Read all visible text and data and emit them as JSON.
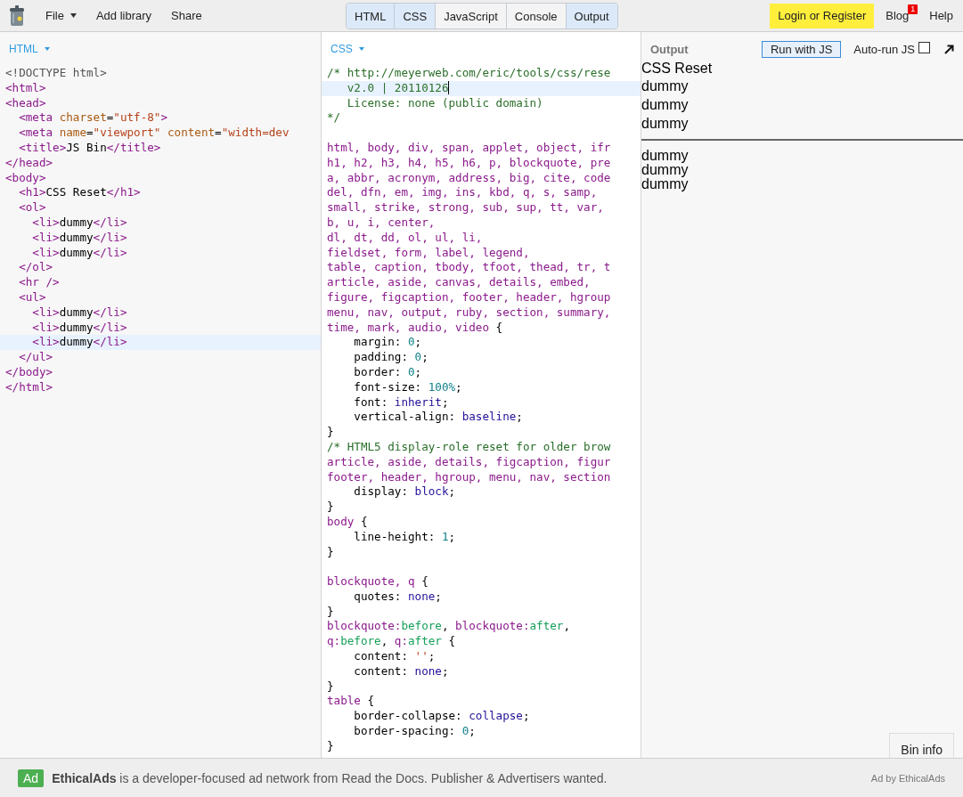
{
  "top_bar": {
    "menu": [
      {
        "label": "File",
        "dropdown": true
      },
      {
        "label": "Add library",
        "dropdown": false
      },
      {
        "label": "Share",
        "dropdown": false
      }
    ],
    "tabs": [
      {
        "label": "HTML",
        "selected": true
      },
      {
        "label": "CSS",
        "selected": true
      },
      {
        "label": "JavaScript",
        "selected": false
      },
      {
        "label": "Console",
        "selected": false
      },
      {
        "label": "Output",
        "selected": true
      }
    ],
    "login": "Login or Register",
    "blog": {
      "label": "Blog",
      "badge": "1"
    },
    "help": "Help"
  },
  "html_pane": {
    "title": "HTML",
    "lines": [
      {
        "active": false,
        "tokens": [
          {
            "kind": "doc",
            "text": "<!DOCTYPE html>"
          }
        ]
      },
      {
        "active": false,
        "tokens": [
          {
            "kind": "tag",
            "text": "<html>"
          }
        ]
      },
      {
        "active": false,
        "tokens": [
          {
            "kind": "tag",
            "text": "<head>"
          }
        ]
      },
      {
        "active": false,
        "tokens": [
          {
            "kind": "tag",
            "text": "  <meta "
          },
          {
            "kind": "attr",
            "text": "charset"
          },
          {
            "kind": "plain",
            "text": "="
          },
          {
            "kind": "str",
            "text": "\"utf-8\""
          },
          {
            "kind": "tag",
            "text": ">"
          }
        ]
      },
      {
        "active": false,
        "tokens": [
          {
            "kind": "tag",
            "text": "  <meta "
          },
          {
            "kind": "attr",
            "text": "name"
          },
          {
            "kind": "plain",
            "text": "="
          },
          {
            "kind": "str",
            "text": "\"viewport\" "
          },
          {
            "kind": "attr",
            "text": "content"
          },
          {
            "kind": "plain",
            "text": "="
          },
          {
            "kind": "str",
            "text": "\"width=dev"
          }
        ]
      },
      {
        "active": false,
        "tokens": [
          {
            "kind": "tag",
            "text": "  <title>"
          },
          {
            "kind": "plain",
            "text": "JS Bin"
          },
          {
            "kind": "tag",
            "text": "</title>"
          }
        ]
      },
      {
        "active": false,
        "tokens": [
          {
            "kind": "tag",
            "text": "</head>"
          }
        ]
      },
      {
        "active": false,
        "tokens": [
          {
            "kind": "tag",
            "text": "<body>"
          }
        ]
      },
      {
        "active": false,
        "tokens": [
          {
            "kind": "tag",
            "text": "  <h1>"
          },
          {
            "kind": "plain",
            "text": "CSS Reset"
          },
          {
            "kind": "tag",
            "text": "</h1>"
          }
        ]
      },
      {
        "active": false,
        "tokens": [
          {
            "kind": "tag",
            "text": "  <ol>"
          }
        ]
      },
      {
        "active": false,
        "tokens": [
          {
            "kind": "tag",
            "text": "    <li>"
          },
          {
            "kind": "plain",
            "text": "dummy"
          },
          {
            "kind": "tag",
            "text": "</li>"
          }
        ]
      },
      {
        "active": false,
        "tokens": [
          {
            "kind": "tag",
            "text": "    <li>"
          },
          {
            "kind": "plain",
            "text": "dummy"
          },
          {
            "kind": "tag",
            "text": "</li>"
          }
        ]
      },
      {
        "active": false,
        "tokens": [
          {
            "kind": "tag",
            "text": "    <li>"
          },
          {
            "kind": "plain",
            "text": "dummy"
          },
          {
            "kind": "tag",
            "text": "</li>"
          }
        ]
      },
      {
        "active": false,
        "tokens": [
          {
            "kind": "tag",
            "text": "  </ol>"
          }
        ]
      },
      {
        "active": false,
        "tokens": [
          {
            "kind": "tag",
            "text": "  <hr />"
          }
        ]
      },
      {
        "active": false,
        "tokens": [
          {
            "kind": "tag",
            "text": "  <ul>"
          }
        ]
      },
      {
        "active": false,
        "tokens": [
          {
            "kind": "tag",
            "text": "    <li>"
          },
          {
            "kind": "plain",
            "text": "dummy"
          },
          {
            "kind": "tag",
            "text": "</li>"
          }
        ]
      },
      {
        "active": false,
        "tokens": [
          {
            "kind": "tag",
            "text": "    <li>"
          },
          {
            "kind": "plain",
            "text": "dummy"
          },
          {
            "kind": "tag",
            "text": "</li>"
          }
        ]
      },
      {
        "active": true,
        "tokens": [
          {
            "kind": "tag",
            "text": "    <li>"
          },
          {
            "kind": "plain",
            "text": "dummy"
          },
          {
            "kind": "tag",
            "text": "</li>"
          }
        ]
      },
      {
        "active": false,
        "tokens": [
          {
            "kind": "tag",
            "text": "  </ul>"
          }
        ]
      },
      {
        "active": false,
        "tokens": [
          {
            "kind": "tag",
            "text": "</body>"
          }
        ]
      },
      {
        "active": false,
        "tokens": [
          {
            "kind": "tag",
            "text": "</html>"
          }
        ]
      }
    ]
  },
  "css_pane": {
    "title": "CSS",
    "lines": [
      {
        "active": false,
        "tokens": [
          {
            "kind": "com",
            "text": "/* http://meyerweb.com/eric/tools/css/rese"
          }
        ]
      },
      {
        "active": true,
        "tokens": [
          {
            "kind": "com",
            "text": "   v2.0 | 20110126"
          }
        ]
      },
      {
        "active": false,
        "tokens": [
          {
            "kind": "com",
            "text": "   License: none (public domain)"
          }
        ]
      },
      {
        "active": false,
        "tokens": [
          {
            "kind": "com",
            "text": "*/"
          }
        ]
      },
      {
        "active": false
      },
      {
        "active": false,
        "tokens": [
          {
            "kind": "sel",
            "text": "html, body, div, span, applet, object, ifr"
          }
        ]
      },
      {
        "active": false,
        "tokens": [
          {
            "kind": "sel",
            "text": "h1, h2, h3, h4, h5, h6, p, blockquote, pre"
          }
        ]
      },
      {
        "active": false,
        "tokens": [
          {
            "kind": "sel",
            "text": "a, abbr, acronym, address, big, cite, code"
          }
        ]
      },
      {
        "active": false,
        "tokens": [
          {
            "kind": "sel",
            "text": "del, dfn, em, img, ins, kbd, q, s, samp,"
          }
        ]
      },
      {
        "active": false,
        "tokens": [
          {
            "kind": "sel",
            "text": "small, strike, strong, sub, sup, tt, var,"
          }
        ]
      },
      {
        "active": false,
        "tokens": [
          {
            "kind": "sel",
            "text": "b, u, i, center,"
          }
        ]
      },
      {
        "active": false,
        "tokens": [
          {
            "kind": "sel",
            "text": "dl, dt, dd, ol, ul, li,"
          }
        ]
      },
      {
        "active": false,
        "tokens": [
          {
            "kind": "sel",
            "text": "fieldset, form, label, legend,"
          }
        ]
      },
      {
        "active": false,
        "tokens": [
          {
            "kind": "sel",
            "text": "table, caption, tbody, tfoot, thead, tr, t"
          }
        ]
      },
      {
        "active": false,
        "tokens": [
          {
            "kind": "sel",
            "text": "article, aside, canvas, details, embed,"
          }
        ]
      },
      {
        "active": false,
        "tokens": [
          {
            "kind": "sel",
            "text": "figure, figcaption, footer, header, hgroup"
          }
        ]
      },
      {
        "active": false,
        "tokens": [
          {
            "kind": "sel",
            "text": "menu, nav, output, ruby, section, summary,"
          }
        ]
      },
      {
        "active": false,
        "tokens": [
          {
            "kind": "sel",
            "text": "time, mark, audio, video"
          },
          {
            "kind": "plain",
            "text": " {"
          }
        ]
      },
      {
        "active": false,
        "tokens": [
          {
            "kind": "plain",
            "text": "    margin: "
          },
          {
            "kind": "num",
            "text": "0"
          },
          {
            "kind": "plain",
            "text": ";"
          }
        ]
      },
      {
        "active": false,
        "tokens": [
          {
            "kind": "plain",
            "text": "    padding: "
          },
          {
            "kind": "num",
            "text": "0"
          },
          {
            "kind": "plain",
            "text": ";"
          }
        ]
      },
      {
        "active": false,
        "tokens": [
          {
            "kind": "plain",
            "text": "    border: "
          },
          {
            "kind": "num",
            "text": "0"
          },
          {
            "kind": "plain",
            "text": ";"
          }
        ]
      },
      {
        "active": false,
        "tokens": [
          {
            "kind": "plain",
            "text": "    font-size: "
          },
          {
            "kind": "num",
            "text": "100%"
          },
          {
            "kind": "plain",
            "text": ";"
          }
        ]
      },
      {
        "active": false,
        "tokens": [
          {
            "kind": "plain",
            "text": "    font: "
          },
          {
            "kind": "kw",
            "text": "inherit"
          },
          {
            "kind": "plain",
            "text": ";"
          }
        ]
      },
      {
        "active": false,
        "tokens": [
          {
            "kind": "plain",
            "text": "    vertical-align: "
          },
          {
            "kind": "kw",
            "text": "baseline"
          },
          {
            "kind": "plain",
            "text": ";"
          }
        ]
      },
      {
        "active": false,
        "tokens": [
          {
            "kind": "plain",
            "text": "}"
          }
        ]
      },
      {
        "active": false,
        "tokens": [
          {
            "kind": "com",
            "text": "/* HTML5 display-role reset for older brow"
          }
        ]
      },
      {
        "active": false,
        "tokens": [
          {
            "kind": "sel",
            "text": "article, aside, details, figcaption, figur"
          }
        ]
      },
      {
        "active": false,
        "tokens": [
          {
            "kind": "sel",
            "text": "footer, header, hgroup, menu, nav, section"
          }
        ]
      },
      {
        "active": false,
        "tokens": [
          {
            "kind": "plain",
            "text": "    display: "
          },
          {
            "kind": "kw",
            "text": "block"
          },
          {
            "kind": "plain",
            "text": ";"
          }
        ]
      },
      {
        "active": false,
        "tokens": [
          {
            "kind": "plain",
            "text": "}"
          }
        ]
      },
      {
        "active": false,
        "tokens": [
          {
            "kind": "sel",
            "text": "body"
          },
          {
            "kind": "plain",
            "text": " {"
          }
        ]
      },
      {
        "active": false,
        "tokens": [
          {
            "kind": "plain",
            "text": "    line-height: "
          },
          {
            "kind": "num",
            "text": "1"
          },
          {
            "kind": "plain",
            "text": ";"
          }
        ]
      },
      {
        "active": false,
        "tokens": [
          {
            "kind": "plain",
            "text": "}"
          }
        ]
      },
      {
        "active": false
      },
      {
        "active": false,
        "tokens": [
          {
            "kind": "sel",
            "text": "blockquote, q"
          },
          {
            "kind": "plain",
            "text": " {"
          }
        ]
      },
      {
        "active": false,
        "tokens": [
          {
            "kind": "plain",
            "text": "    quotes: "
          },
          {
            "kind": "kw",
            "text": "none"
          },
          {
            "kind": "plain",
            "text": ";"
          }
        ]
      },
      {
        "active": false,
        "tokens": [
          {
            "kind": "plain",
            "text": "}"
          }
        ]
      },
      {
        "active": false,
        "tokens": [
          {
            "kind": "sel",
            "text": "blockquote:"
          },
          {
            "kind": "pse",
            "text": "before"
          },
          {
            "kind": "plain",
            "text": ", "
          },
          {
            "kind": "sel",
            "text": "blockquote:"
          },
          {
            "kind": "pse",
            "text": "after"
          },
          {
            "kind": "plain",
            "text": ","
          }
        ]
      },
      {
        "active": false,
        "tokens": [
          {
            "kind": "sel",
            "text": "q:"
          },
          {
            "kind": "pse",
            "text": "before"
          },
          {
            "kind": "plain",
            "text": ", "
          },
          {
            "kind": "sel",
            "text": "q:"
          },
          {
            "kind": "pse",
            "text": "after"
          },
          {
            "kind": "plain",
            "text": " {"
          }
        ]
      },
      {
        "active": false,
        "tokens": [
          {
            "kind": "plain",
            "text": "    content: "
          },
          {
            "kind": "str",
            "text": "''"
          },
          {
            "kind": "plain",
            "text": ";"
          }
        ]
      },
      {
        "active": false,
        "tokens": [
          {
            "kind": "plain",
            "text": "    content: "
          },
          {
            "kind": "kw",
            "text": "none"
          },
          {
            "kind": "plain",
            "text": ";"
          }
        ]
      },
      {
        "active": false,
        "tokens": [
          {
            "kind": "plain",
            "text": "}"
          }
        ]
      },
      {
        "active": false,
        "tokens": [
          {
            "kind": "sel",
            "text": "table"
          },
          {
            "kind": "plain",
            "text": " {"
          }
        ]
      },
      {
        "active": false,
        "tokens": [
          {
            "kind": "plain",
            "text": "    border-collapse: "
          },
          {
            "kind": "kw",
            "text": "collapse"
          },
          {
            "kind": "plain",
            "text": ";"
          }
        ]
      },
      {
        "active": false,
        "tokens": [
          {
            "kind": "plain",
            "text": "    border-spacing: "
          },
          {
            "kind": "num",
            "text": "0"
          },
          {
            "kind": "plain",
            "text": ";"
          }
        ]
      },
      {
        "active": false,
        "tokens": [
          {
            "kind": "plain",
            "text": "}"
          }
        ]
      }
    ]
  },
  "output_pane": {
    "title": "Output",
    "run_button": "Run with JS",
    "auto_run": {
      "label": "Auto-run JS",
      "checked": false
    },
    "preview": {
      "heading": "CSS Reset",
      "ordered_items": [
        "dummy",
        "dummy",
        "dummy"
      ],
      "unordered_items": [
        "dummy",
        "dummy",
        "dummy"
      ]
    },
    "bin_info": "Bin info"
  },
  "ad_bar": {
    "badge": "Ad",
    "text": "**EthicalAds** is a developer-focused ad network from Read the Docs. Publisher & Advertisers wanted.",
    "credit": "Ad by EthicalAds"
  }
}
